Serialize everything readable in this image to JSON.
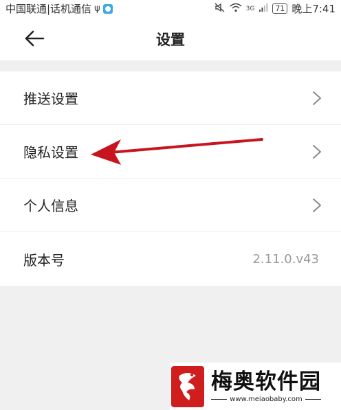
{
  "status_bar": {
    "carrier": "中国联通|话机通信",
    "usb_icon": "usb-icon",
    "app_icon": "app-notification-icon",
    "mute_icon": "mute-icon",
    "wifi_icon": "wifi-icon",
    "network": "3G",
    "signal_icon": "signal-icon",
    "battery": "71",
    "time": "晚上7:41"
  },
  "header": {
    "back_icon": "back-arrow-icon",
    "title": "设置"
  },
  "settings": {
    "items": [
      {
        "label": "推送设置",
        "icon": "chevron-right-icon"
      },
      {
        "label": "隐私设置",
        "icon": "chevron-right-icon"
      },
      {
        "label": "个人信息",
        "icon": "chevron-right-icon"
      }
    ],
    "version": {
      "label": "版本号",
      "value": "2.11.0.v43"
    }
  },
  "annotation": {
    "arrow_color": "#c8141e"
  },
  "watermark": {
    "name": "梅奥软件园",
    "url": "www.meiaobaby.com",
    "logo_color": "#d01e1e"
  }
}
